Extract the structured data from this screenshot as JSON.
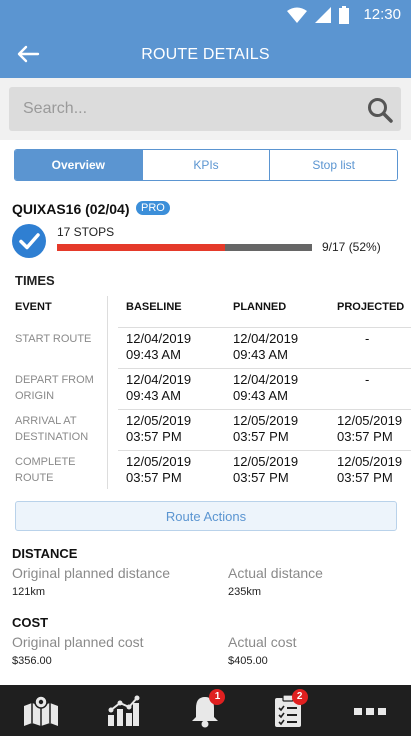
{
  "status_bar": {
    "time": "12:30",
    "icons": [
      "wifi-icon",
      "signal-icon",
      "battery-icon"
    ]
  },
  "app_bar": {
    "title": "ROUTE DETAILS",
    "back_icon": "back-arrow-icon"
  },
  "search": {
    "placeholder": "Search...",
    "value": "",
    "icon": "search-icon"
  },
  "tabs": [
    {
      "label": "Overview",
      "active": true
    },
    {
      "label": "KPIs",
      "active": false
    },
    {
      "label": "Stop list",
      "active": false
    }
  ],
  "route": {
    "name": "QUIXAS16 (02/04)",
    "badge": "PRO",
    "stops_label": "17 STOPS",
    "progress_text": "9/17 (52%)",
    "progress_fraction": 0.66
  },
  "times": {
    "title": "TIMES",
    "headers": [
      "EVENT",
      "BASELINE",
      "PLANNED",
      "PROJECTED"
    ],
    "rows": [
      {
        "event": "START ROUTE",
        "baseline": [
          "12/04/2019",
          "09:43 AM"
        ],
        "planned": [
          "12/04/2019",
          "09:43 AM"
        ],
        "projected": [
          "-"
        ]
      },
      {
        "event": "DEPART FROM ORIGIN",
        "baseline": [
          "12/04/2019",
          "09:43 AM"
        ],
        "planned": [
          "12/04/2019",
          "09:43 AM"
        ],
        "projected": [
          "-"
        ]
      },
      {
        "event": "ARRIVAL AT DESTINATION",
        "baseline": [
          "12/05/2019",
          "03:57 PM"
        ],
        "planned": [
          "12/05/2019",
          "03:57 PM"
        ],
        "projected": [
          "12/05/2019",
          "03:57 PM"
        ]
      },
      {
        "event": "COMPLETE ROUTE",
        "baseline": [
          "12/05/2019",
          "03:57 PM"
        ],
        "planned": [
          "12/05/2019",
          "03:57 PM"
        ],
        "projected": [
          "12/05/2019",
          "03:57 PM"
        ]
      }
    ]
  },
  "route_actions_label": "Route Actions",
  "distance": {
    "title": "DISTANCE",
    "planned_label": "Original planned distance",
    "planned_value": "121km",
    "actual_label": "Actual distance",
    "actual_value": "235km"
  },
  "cost": {
    "title": "COST",
    "planned_label": "Original planned cost",
    "planned_value": "$356.00",
    "actual_label": "Actual cost",
    "actual_value": "$405.00"
  },
  "bottom_nav": [
    {
      "icon": "map-icon",
      "badge": ""
    },
    {
      "icon": "analytics-icon",
      "badge": ""
    },
    {
      "icon": "bell-icon",
      "badge": "1"
    },
    {
      "icon": "checklist-icon",
      "badge": "2"
    },
    {
      "icon": "more-icon",
      "badge": ""
    }
  ],
  "colors": {
    "primary": "#5b95d1",
    "progress_fill": "#e53a2a",
    "progress_track": "#666666",
    "badge": "#e02020",
    "nav_bg": "#1f1f1f"
  }
}
